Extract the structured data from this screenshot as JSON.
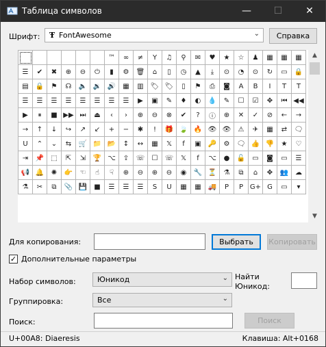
{
  "window": {
    "title": "Таблица символов",
    "minimize_glyph": "—",
    "maximize_glyph": "☐",
    "close_glyph": "✕"
  },
  "font_row": {
    "label": "Шрифт:",
    "font_icon_glyph": "Ŧ",
    "selected_font": "FontAwesome",
    "help_button": "Справка"
  },
  "grid": {
    "icons": [
      "",
      "",
      "",
      "",
      "",
      "",
      "™",
      "∞",
      "≠",
      "Y",
      "♫",
      "⚲",
      "✉",
      "♥",
      "★",
      "☆",
      "♟",
      "▦",
      "▦",
      "▦",
      "☰",
      "✔",
      "✖",
      "⊕",
      "⊖",
      "⏻",
      "▮",
      "⚙",
      "🗑",
      "⌂",
      "▯",
      "◷",
      "▲",
      "⤓",
      "⊙",
      "◔",
      "⊙",
      "↻",
      "▭",
      "🔒",
      "▤",
      "🔒",
      "⚑",
      "☊",
      "🔈",
      "🔉",
      "🔊",
      "▦",
      "▥",
      "🏷",
      "🏷",
      "▯",
      "⚑",
      "⎙",
      "◙",
      "A",
      "B",
      "I",
      "T",
      "T",
      "☰",
      "☰",
      "☰",
      "☰",
      "☰",
      "☰",
      "☰",
      "☰",
      "▶",
      "▣",
      "✎",
      "♦",
      "◐",
      "💧",
      "✎",
      "☐",
      "☑",
      "✥",
      "⏮",
      "◀◀",
      "▶",
      "⏸",
      "■",
      "▶▶",
      "⏭",
      "⏏",
      "‹",
      "›",
      "⊕",
      "⊖",
      "⊗",
      "✔",
      "?",
      "ⓘ",
      "⊕",
      "✕",
      "✓",
      "⊘",
      "←",
      "→",
      "→",
      "↑",
      "↓",
      "↪",
      "↗",
      "↙",
      "+",
      "−",
      "✱",
      "!",
      "🎁",
      "🍃",
      "🔥",
      "👁",
      "👁",
      "⚠",
      "✈",
      "▦",
      "⇄",
      "🗨",
      "U",
      "⌃",
      "⌄",
      "⇆",
      "🛒",
      "📁",
      "📂",
      "↕",
      "↔",
      "▦",
      "𝕏",
      "f",
      "▣",
      "🔑",
      "⚙",
      "🗨",
      "👍",
      "👎",
      "★",
      "♡",
      "⇥",
      "📌",
      "⬚",
      "⇱",
      "⇲",
      "🏆",
      "⌥",
      "⇪",
      "☏",
      "☐",
      "☏",
      "𝕏",
      "f",
      "⌥",
      "●",
      "🔓",
      "▭",
      "◙",
      "▭",
      "☰",
      "📢",
      "🔔",
      "✺",
      "👉",
      "☜",
      "☝",
      "☟",
      "⊕",
      "⊖",
      "⊕",
      "⊖",
      "◉",
      "🔧",
      "⏳",
      "⚗",
      "⧉",
      "⌂",
      "✥",
      "👥",
      "☁",
      "⚗",
      "✂",
      "⧉",
      "📎",
      "💾",
      "■",
      "☰",
      "☰",
      "☰",
      "S",
      "U",
      "▦",
      "▦",
      "🚚",
      "P",
      "P",
      "G+",
      "G",
      "▭",
      "▾"
    ],
    "selected_index": 0
  },
  "copy_row": {
    "label": "Для копирования:",
    "value": "",
    "select_button": "Выбрать",
    "copy_button": "Копировать"
  },
  "advanced": {
    "label": "Дополнительные параметры",
    "checked": true,
    "check_glyph": "✓"
  },
  "charset": {
    "label": "Набор символов:",
    "value": "Юникод"
  },
  "find_unicode": {
    "label_line1": "Найти",
    "label_line2": "Юникод:",
    "value": ""
  },
  "grouping": {
    "label": "Группировка:",
    "value": "Все"
  },
  "search": {
    "label": "Поиск:",
    "value": "",
    "button": "Поиск"
  },
  "status": {
    "code": "U+00A8: Diaeresis",
    "keystroke": "Клавиша: Alt+0168"
  },
  "dropdown_glyph": "⌄",
  "scroll": {
    "up_glyph": "▲",
    "down_glyph": "▼"
  }
}
